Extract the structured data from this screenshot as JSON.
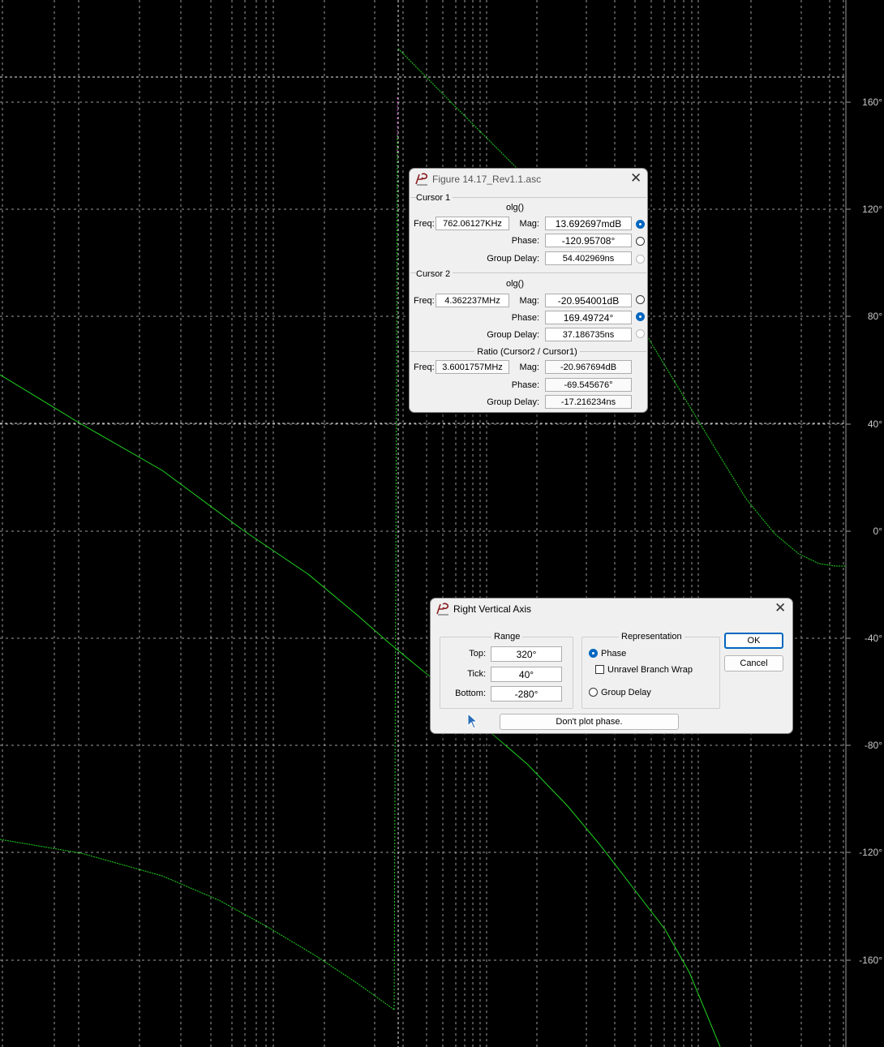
{
  "plot": {
    "background": "#000000",
    "trace_color": "#1fd41f",
    "grid_color": "#cfcfcf",
    "right_axis_ticks": [
      "160°",
      "120°",
      "80°",
      "40°",
      "0°",
      "-40°",
      "-80°",
      "-120°",
      "-160°"
    ]
  },
  "cursor_window": {
    "title": "Figure 14.17_Rev1.1.asc",
    "cursor1": {
      "label": "Cursor 1",
      "expr": "olg()",
      "freq_label": "Freq:",
      "freq": "762.06127KHz",
      "mag_label": "Mag:",
      "mag": "13.692697mdB",
      "phase_label": "Phase:",
      "phase": "-120.95708°",
      "gd_label": "Group Delay:",
      "gd": "54.402969ns"
    },
    "cursor2": {
      "label": "Cursor 2",
      "expr": "olg()",
      "freq_label": "Freq:",
      "freq": "4.362237MHz",
      "mag_label": "Mag:",
      "mag": "-20.954001dB",
      "phase_label": "Phase:",
      "phase": "169.49724°",
      "gd_label": "Group Delay:",
      "gd": "37.186735ns"
    },
    "ratio": {
      "label": "Ratio (Cursor2 / Cursor1)",
      "freq_label": "Freq:",
      "freq": "3.6001757MHz",
      "mag_label": "Mag:",
      "mag": "-20.967694dB",
      "phase_label": "Phase:",
      "phase": "-69.545676°",
      "gd_label": "Group Delay:",
      "gd": "-17.216234ns"
    }
  },
  "axis_dialog": {
    "title": "Right Vertical Axis",
    "range": {
      "label": "Range",
      "top_label": "Top:",
      "top": "320°",
      "tick_label": "Tick:",
      "tick": "40°",
      "bottom_label": "Bottom:",
      "bottom": "-280°"
    },
    "representation": {
      "label": "Representation",
      "phase": "Phase",
      "unravel": "Unravel Branch Wrap",
      "group_delay": "Group Delay",
      "selected": "Phase"
    },
    "ok": "OK",
    "cancel": "Cancel",
    "dont_plot": "Don't plot phase."
  }
}
